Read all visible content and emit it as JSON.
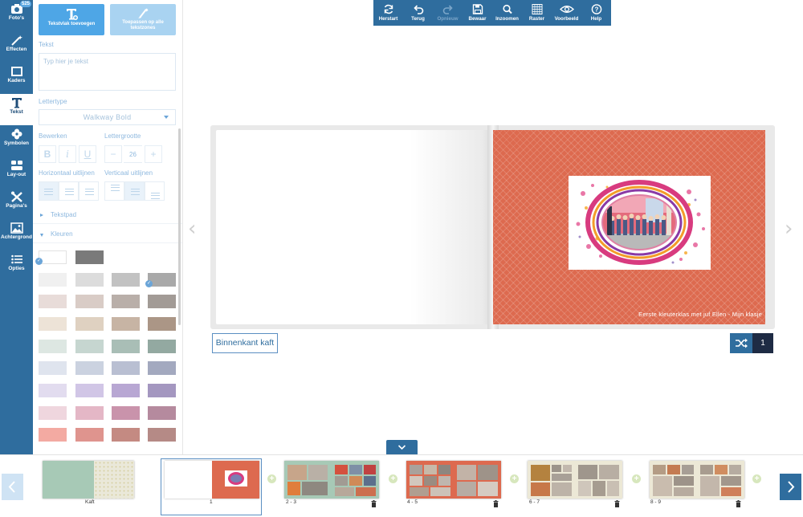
{
  "sidebar": {
    "items": [
      {
        "key": "fotos",
        "label": "Foto's",
        "badge": "525"
      },
      {
        "key": "effecten",
        "label": "Effecten"
      },
      {
        "key": "kaders",
        "label": "Kaders"
      },
      {
        "key": "tekst",
        "label": "Tekst",
        "active": true
      },
      {
        "key": "symbolen",
        "label": "Symbolen"
      },
      {
        "key": "layout",
        "label": "Lay-out"
      },
      {
        "key": "paginas",
        "label": "Pagina's"
      },
      {
        "key": "achtergrond",
        "label": "Achtergrond"
      },
      {
        "key": "opties",
        "label": "Opties"
      }
    ]
  },
  "panel": {
    "add_text_label": "Tekstvlak toevoegen",
    "apply_all_label": "Toepassen op alle tekstzones",
    "text_section": "Tekst",
    "text_placeholder": "Typ hier je tekst",
    "font_section": "Lettertype",
    "font_value": "Walkway Bold",
    "edit_section": "Bewerken",
    "size_section": "Lettergrootte",
    "size_value": "26",
    "halign_section": "Horizontaal uitlijnen",
    "valign_section": "Verticaal uitlijnen",
    "textpath_label": "Tekstpad",
    "colors_label": "Kleuren"
  },
  "toolbar": {
    "items": [
      {
        "label": "Herstart",
        "icon": "refresh-icon"
      },
      {
        "label": "Terug",
        "icon": "undo-icon"
      },
      {
        "label": "Opnieuw",
        "icon": "redo-icon",
        "disabled": true
      },
      {
        "label": "Bewaar",
        "icon": "save-icon"
      },
      {
        "label": "Inzoomen",
        "icon": "zoom-icon"
      },
      {
        "label": "Raster",
        "icon": "grid-icon"
      },
      {
        "label": "Voorbeeld",
        "icon": "eye-icon"
      },
      {
        "label": "Help",
        "icon": "help-icon"
      }
    ]
  },
  "book": {
    "caption": "Eerste kleuterklas met juf Ellen - Mijn klasje",
    "page_name": "Binnenkant kaft",
    "page_number": "1"
  },
  "filmstrip": {
    "thumbs": [
      {
        "label": "Kaft"
      },
      {
        "label": "1"
      },
      {
        "label": "2 - 3"
      },
      {
        "label": "4 - 5"
      },
      {
        "label": "6 - 7"
      },
      {
        "label": "8 - 9"
      }
    ]
  },
  "colors": {
    "brand": "#2f6d9e",
    "accent": "#4ea6e6",
    "page_bg": "#dd6a4f",
    "dark": "#1e2b44"
  },
  "swatches": [
    [
      "#ffffff",
      "#7a7a7a"
    ],
    [
      "#f0f0f0",
      "#dcdcdc",
      "#c2c2c2",
      "#a9a9a9"
    ],
    [
      "#e8dcd9",
      "#d9ccc6",
      "#b9afa9",
      "#a29b96"
    ],
    [
      "#ede3d7",
      "#dfd1c1",
      "#c7b4a4",
      "#ab9686"
    ],
    [
      "#dde7e2",
      "#c6d6d0",
      "#a9beb6",
      "#93a9a1"
    ],
    [
      "#dfe4ee",
      "#cbd2e0",
      "#b9bfd2",
      "#a3a9bf"
    ],
    [
      "#e2dcef",
      "#d1c6e6",
      "#b8a7d3",
      "#a497c0"
    ],
    [
      "#efd6de",
      "#e4b7c6",
      "#c993ab",
      "#b58a9e"
    ],
    [
      "#f3aaa2",
      "#df948e",
      "#c48a82",
      "#b58a86"
    ]
  ]
}
